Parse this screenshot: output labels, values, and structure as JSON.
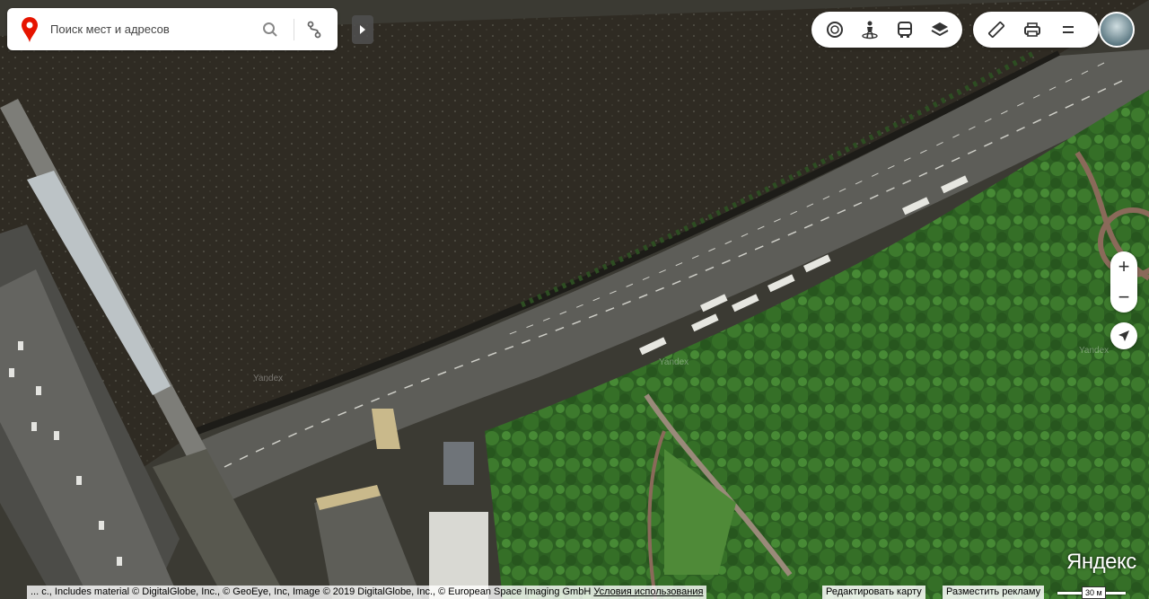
{
  "search": {
    "placeholder": "Поиск мест и адресов"
  },
  "icons": {
    "logo": "yandex-maps-pin-icon",
    "search": "search-icon",
    "route": "route-icon",
    "collapse": "chevron-right-icon",
    "panorama": "panorama-icon",
    "people": "street-view-icon",
    "transport": "bus-icon",
    "layers": "layers-icon",
    "ruler": "ruler-icon",
    "print": "print-icon",
    "menu": "menu-icon",
    "zoom_in": "plus-icon",
    "zoom_out": "minus-icon",
    "geolocation": "geolocation-arrow-icon"
  },
  "controls": {
    "zoom_in": "+",
    "zoom_out": "−"
  },
  "watermarks": [
    "Yandex",
    "Yandex",
    "Yandex"
  ],
  "brand": "Яндекс",
  "footer": {
    "copyright": "... c., Includes material © DigitalGlobe, Inc., © GeoEye, Inc, Image © 2019 DigitalGlobe, Inc., © European Space Imaging GmbH",
    "terms_link": "Условия использования",
    "edit_map": "Редактировать карту",
    "ads": "Разместить рекламу",
    "scale_label": "30 м"
  },
  "colors": {
    "accent_red": "#e61400",
    "water": "#2e2a22",
    "greenery": "#2f6a25",
    "road": "#5c5c58"
  }
}
